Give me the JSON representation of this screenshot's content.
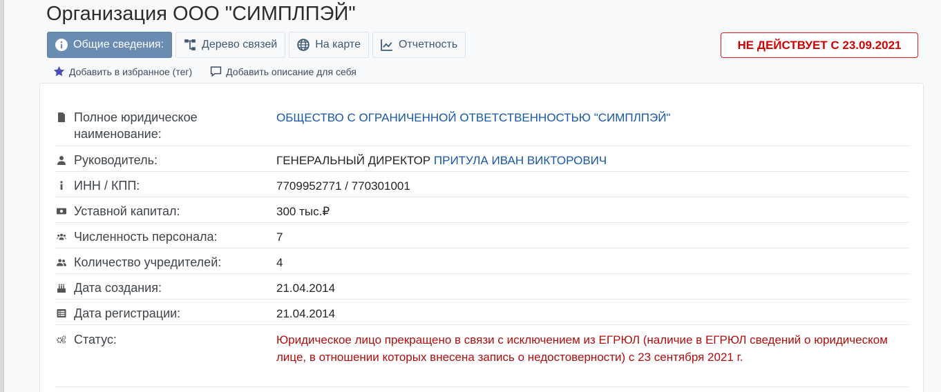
{
  "page_title": "Организация ООО \"СИМПЛПЭЙ\"",
  "tabs": [
    {
      "label": "Общие сведения:",
      "icon": "info-circle-icon",
      "active": true
    },
    {
      "label": "Дерево связей",
      "icon": "sitemap-icon",
      "active": false
    },
    {
      "label": "На карте",
      "icon": "globe-icon",
      "active": false
    },
    {
      "label": "Отчетность",
      "icon": "line-chart-icon",
      "active": false
    }
  ],
  "status_badge": "НЕ ДЕЙСТВУЕТ С 23.09.2021",
  "actions": {
    "favorite": "Добавить в избранное (тег)",
    "description": "Добавить описание для себя"
  },
  "info": {
    "full_name": {
      "label": "Полное юридическое наименование:",
      "value": "ОБЩЕСТВО С ОГРАНИЧЕННОЙ ОТВЕТСТВЕННОСТЬЮ \"СИМПЛПЭЙ\""
    },
    "head": {
      "label": "Руководитель:",
      "position": "ГЕНЕРАЛЬНЫЙ ДИРЕКТОР",
      "name": "ПРИТУЛА ИВАН ВИКТОРОВИЧ"
    },
    "inn_kpp": {
      "label": "ИНН / КПП:",
      "value": "7709952771 / 770301001"
    },
    "capital": {
      "label": "Уставной капитал:",
      "value": "300 тыс.₽"
    },
    "staff": {
      "label": "Численность персонала:",
      "value": "7"
    },
    "founders": {
      "label": "Количество учредителей:",
      "value": "4"
    },
    "created": {
      "label": "Дата создания:",
      "value": "21.04.2014"
    },
    "registered": {
      "label": "Дата регистрации:",
      "value": "21.04.2014"
    },
    "status": {
      "label": "Статус:",
      "value": "Юридическое лицо прекращено в связи с исключением из ЕГРЮЛ (наличие в ЕГРЮЛ сведений о юридическом лице, в отношении которых внесена запись о недостоверности) с 23 сентября 2021 г."
    }
  },
  "colors": {
    "active_tab": "#6b8cb2",
    "badge_red": "#d00000",
    "link_blue": "#1756a8",
    "status_red": "#b10d0d"
  }
}
